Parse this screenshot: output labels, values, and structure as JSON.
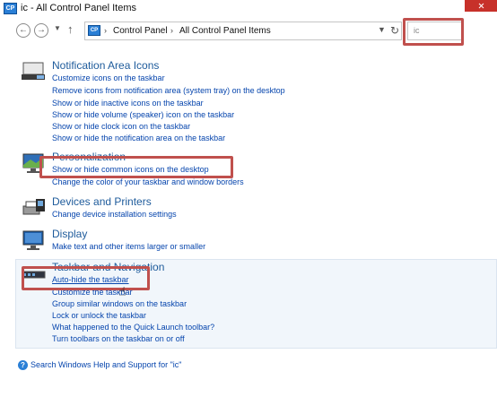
{
  "window": {
    "title": "ic - All Control Panel Items",
    "icon_label": "CP"
  },
  "address": {
    "breadcrumbs": [
      "Control Panel",
      "All Control Panel Items"
    ],
    "separator": "›"
  },
  "search": {
    "value": "ic"
  },
  "categories": [
    {
      "title": "Notification Area Icons",
      "icon": "notification-area-icon",
      "links": [
        "Customize icons on the taskbar",
        "Remove icons from notification area (system tray) on the desktop",
        "Show or hide inactive icons on the taskbar",
        "Show or hide volume (speaker) icon on the taskbar",
        "Show or hide clock icon on the taskbar",
        "Show or hide the notification area on the taskbar"
      ]
    },
    {
      "title": "Personalization",
      "icon": "personalization-icon",
      "links": [
        "Show or hide common icons on the desktop",
        "Change the color of your taskbar and window borders"
      ]
    },
    {
      "title": "Devices and Printers",
      "icon": "devices-printers-icon",
      "links": [
        "Change device installation settings"
      ]
    },
    {
      "title": "Display",
      "icon": "display-icon",
      "links": [
        "Make text and other items larger or smaller"
      ]
    },
    {
      "title": "Taskbar and Navigation",
      "icon": "taskbar-icon",
      "links": [
        "Auto-hide the taskbar",
        "Customize the taskbar",
        "Group similar windows on the taskbar",
        "Lock or unlock the taskbar",
        "What happened to the Quick Launch toolbar?",
        "Turn toolbars on the taskbar on or off"
      ]
    }
  ],
  "help": {
    "text": "Search Windows Help and Support for \"ic\""
  },
  "colors": {
    "highlight": "#c0504d",
    "link": "#0645ad",
    "category_title": "#1e5b9b"
  }
}
